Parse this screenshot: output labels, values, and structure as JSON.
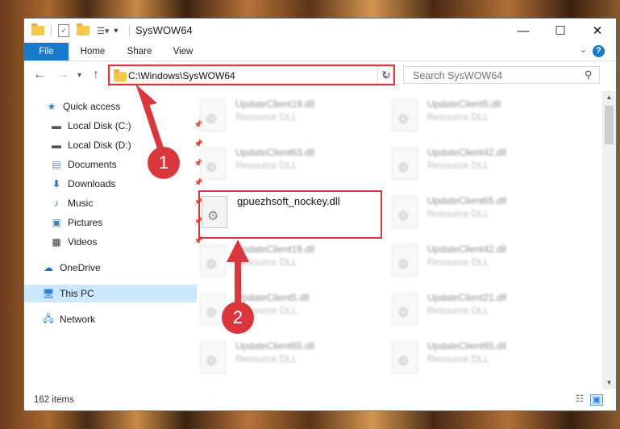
{
  "window": {
    "title": "SysWOW64"
  },
  "titlebar": {
    "minimize": "—",
    "maximize": "☐",
    "close": "✕"
  },
  "ribbon": {
    "tabs": [
      "File",
      "Home",
      "Share",
      "View"
    ],
    "help": "?"
  },
  "address": {
    "path": "C:\\Windows\\SysWOW64"
  },
  "search": {
    "placeholder": "Search SysWOW64"
  },
  "sidebar": {
    "items": [
      {
        "label": "Quick access",
        "icon": "star-icon"
      },
      {
        "label": "Local Disk (C:)",
        "icon": "drive-icon",
        "pinned": true
      },
      {
        "label": "Local Disk (D:)",
        "icon": "drive-icon",
        "pinned": true
      },
      {
        "label": "Documents",
        "icon": "documents-icon",
        "pinned": true
      },
      {
        "label": "Downloads",
        "icon": "download-icon",
        "pinned": true
      },
      {
        "label": "Music",
        "icon": "music-icon",
        "pinned": true
      },
      {
        "label": "Pictures",
        "icon": "pictures-icon",
        "pinned": true
      },
      {
        "label": "Videos",
        "icon": "videos-icon",
        "pinned": true
      },
      {
        "label": "OneDrive",
        "icon": "cloud-icon"
      },
      {
        "label": "This PC",
        "icon": "computer-icon",
        "selected": true
      },
      {
        "label": "Network",
        "icon": "network-icon"
      }
    ]
  },
  "files": [
    {
      "name": "UpdateClient19.dll",
      "type": "Resource DLL"
    },
    {
      "name": "UpdateClient5.dll",
      "type": "Resource DLL"
    },
    {
      "name": "UpdateClient63.dll",
      "type": "Resource DLL"
    },
    {
      "name": "UpdateClient42.dll",
      "type": "Resource DLL"
    },
    {
      "name": "gpuezhsoft_nockey.dll",
      "type": ""
    },
    {
      "name": "UpdateClient65.dll",
      "type": "Resource DLL"
    },
    {
      "name": "UpdateClient19.dll",
      "type": "Resource DLL"
    },
    {
      "name": "UpdateClient42.dll",
      "type": "Resource DLL"
    },
    {
      "name": "UpdateClient5.dll",
      "type": "Resource DLL"
    },
    {
      "name": "UpdateClient21.dll",
      "type": "Resource DLL"
    },
    {
      "name": "UpdateClient65.dll",
      "type": "Resource DLL"
    },
    {
      "name": "UpdateClient65.dll",
      "type": "Resource DLL"
    }
  ],
  "status": {
    "count": "162 items"
  },
  "annotations": {
    "step1": "1",
    "step2": "2"
  },
  "colors": {
    "accent": "#1979ca",
    "annotation": "#d9363e",
    "selected": "#cce8ff"
  }
}
